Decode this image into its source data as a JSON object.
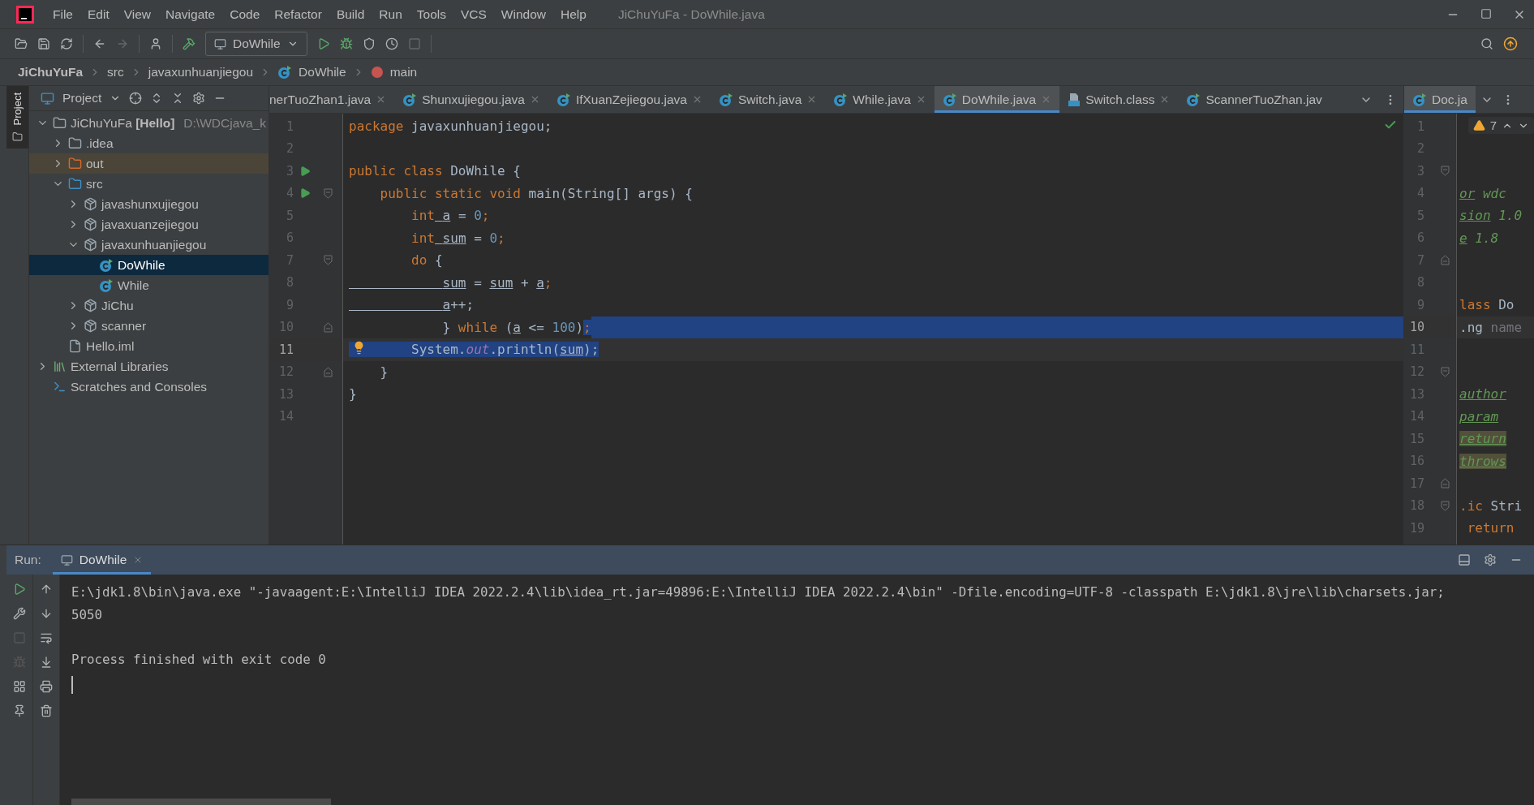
{
  "window": {
    "title": "JiChuYuFa - DoWhile.java"
  },
  "menu": [
    "File",
    "Edit",
    "View",
    "Navigate",
    "Code",
    "Refactor",
    "Build",
    "Run",
    "Tools",
    "VCS",
    "Window",
    "Help"
  ],
  "toolbar": {
    "run_configuration": "DoWhile"
  },
  "breadcrumbs": [
    {
      "label": "JiChuYuFa",
      "kind": "project"
    },
    {
      "label": "src",
      "kind": "folder"
    },
    {
      "label": "javaxunhuanjiegou",
      "kind": "folder"
    },
    {
      "label": "DoWhile",
      "kind": "class"
    },
    {
      "label": "main",
      "kind": "method"
    }
  ],
  "side_strip": {
    "label": "Project"
  },
  "project_panel": {
    "title": "Project",
    "tree": [
      {
        "label": "JiChuYuFa **[Hello]**",
        "path": "D:\\WDCjava_k",
        "kind": "module",
        "expanded": true,
        "selected": false,
        "children": [
          {
            "label": ".idea",
            "kind": "folder",
            "expanded": false,
            "selected": false
          },
          {
            "label": "out",
            "kind": "excluded",
            "expanded": false,
            "selected": false
          },
          {
            "label": "src",
            "kind": "source",
            "expanded": true,
            "selected": false,
            "children": [
              {
                "label": "javashunxujiegou",
                "kind": "package",
                "expanded": false,
                "selected": false
              },
              {
                "label": "javaxuanzejiegou",
                "kind": "package",
                "expanded": false,
                "selected": false
              },
              {
                "label": "javaxunhuanjiegou",
                "kind": "package",
                "expanded": true,
                "selected": false,
                "children": [
                  {
                    "label": "DoWhile",
                    "kind": "class",
                    "selected": true
                  },
                  {
                    "label": "While",
                    "kind": "class",
                    "selected": false
                  }
                ]
              },
              {
                "label": "JiChu",
                "kind": "package",
                "expanded": false,
                "selected": false
              },
              {
                "label": "scanner",
                "kind": "package",
                "expanded": false,
                "selected": false
              }
            ]
          },
          {
            "label": "Hello.iml",
            "kind": "iml",
            "selected": false
          }
        ]
      },
      {
        "label": "External Libraries",
        "kind": "libraries",
        "expanded": false,
        "selected": false
      },
      {
        "label": "Scratches and Consoles",
        "kind": "scratches",
        "selected": false
      }
    ]
  },
  "editor_tabs": [
    {
      "label": "nerTuoZhan1.java",
      "selected": false,
      "closable": true
    },
    {
      "label": "Shunxujiegou.java",
      "kind": "class",
      "selected": false,
      "closable": true
    },
    {
      "label": "IfXuanZejiegou.java",
      "kind": "class",
      "selected": false,
      "closable": true
    },
    {
      "label": "Switch.java",
      "kind": "class",
      "selected": false,
      "closable": true
    },
    {
      "label": "While.java",
      "kind": "class",
      "selected": false,
      "closable": true
    },
    {
      "label": "DoWhile.java",
      "kind": "class",
      "selected": true,
      "closable": true
    },
    {
      "label": "Switch.class",
      "kind": "compiled",
      "selected": false,
      "closable": true
    },
    {
      "label": "ScannerTuoZhan.jav",
      "kind": "class",
      "selected": false,
      "closable": false
    }
  ],
  "editor": {
    "inspection_ok": true,
    "lines": [
      {
        "number": "1",
        "kind": "plain",
        "tokens": [
          {
            "text": "package",
            "kind": "keyword",
            "selected": false
          },
          {
            "text": " javaxunhuanjiegou;",
            "kind": "plain",
            "selected": false
          }
        ]
      },
      {
        "number": "2",
        "kind": "plain"
      },
      {
        "number": "3",
        "kind": "plain",
        "run_marker": true,
        "tokens": [
          {
            "text": "public class",
            "kind": "keyword",
            "selected": false
          },
          {
            "text": " DoWhile {",
            "kind": "plain",
            "selected": false
          }
        ]
      },
      {
        "number": "4",
        "kind": "fold_start",
        "run_marker": true,
        "tokens": [
          {
            "text": "    public static void",
            "kind": "keyword",
            "selected": false
          },
          {
            "text": " main(String[] args) {",
            "kind": "plain",
            "selected": false
          }
        ]
      },
      {
        "number": "5",
        "kind": "plain",
        "tokens": [
          {
            "text": "        int",
            "kind": "keyword",
            "selected": false
          },
          {
            "text": " a",
            "kind": "variable",
            "selected": false
          },
          {
            "text": " = ",
            "kind": "plain",
            "selected": false
          },
          {
            "text": "0",
            "kind": "number",
            "selected": false
          },
          {
            "text": ";",
            "kind": "keyword",
            "selected": false
          }
        ]
      },
      {
        "number": "6",
        "kind": "plain",
        "tokens": [
          {
            "text": "        int",
            "kind": "keyword",
            "selected": false
          },
          {
            "text": " sum",
            "kind": "variable",
            "selected": false
          },
          {
            "text": " = ",
            "kind": "plain",
            "selected": false
          },
          {
            "text": "0",
            "kind": "number",
            "selected": false
          },
          {
            "text": ";",
            "kind": "keyword",
            "selected": false
          }
        ]
      },
      {
        "number": "7",
        "kind": "fold_start",
        "tokens": [
          {
            "text": "        do",
            "kind": "keyword",
            "selected": false
          },
          {
            "text": " {",
            "kind": "plain",
            "selected": false
          }
        ]
      },
      {
        "number": "8",
        "kind": "plain",
        "tokens": [
          {
            "text": "            sum",
            "kind": "variable",
            "selected": false
          },
          {
            "text": " = ",
            "kind": "plain",
            "selected": false
          },
          {
            "text": "sum",
            "kind": "variable",
            "selected": false
          },
          {
            "text": " + ",
            "kind": "plain",
            "selected": false
          },
          {
            "text": "a",
            "kind": "variable",
            "selected": false
          },
          {
            "text": ";",
            "kind": "keyword",
            "selected": false
          }
        ]
      },
      {
        "number": "9",
        "kind": "plain",
        "tokens": [
          {
            "text": "            a",
            "kind": "variable",
            "selected": false
          },
          {
            "text": "++;",
            "kind": "plain",
            "selected": false
          }
        ]
      },
      {
        "number": "10",
        "kind": "fold_end",
        "selected_to_end": true,
        "tokens": [
          {
            "text": "            } ",
            "kind": "plain",
            "selected": false
          },
          {
            "text": "while",
            "kind": "keyword",
            "selected": false
          },
          {
            "text": " (",
            "kind": "plain",
            "selected": false
          },
          {
            "text": "a",
            "kind": "variable",
            "selected": false
          },
          {
            "text": " <= ",
            "kind": "plain",
            "selected": false
          },
          {
            "text": "100",
            "kind": "number",
            "selected": false
          },
          {
            "text": ")",
            "kind": "plain",
            "selected": false
          },
          {
            "text": ";",
            "kind": "keyword",
            "selected": true
          }
        ]
      },
      {
        "number": "11",
        "kind": "plain",
        "current": true,
        "intention_bulb": true,
        "tokens": [
          {
            "text": "        System.",
            "kind": "plain",
            "selected": true
          },
          {
            "text": "out",
            "kind": "static",
            "selected": true
          },
          {
            "text": ".println(",
            "kind": "plain",
            "selected": true
          },
          {
            "text": "sum",
            "kind": "variable",
            "selected": true
          },
          {
            "text": ");",
            "kind": "plain",
            "selected": true
          }
        ]
      },
      {
        "number": "12",
        "kind": "fold_end",
        "tokens": [
          {
            "text": "    }",
            "kind": "plain",
            "selected": false
          }
        ]
      },
      {
        "number": "13",
        "kind": "plain",
        "tokens": [
          {
            "text": "}",
            "kind": "plain",
            "selected": false
          }
        ]
      },
      {
        "number": "14",
        "kind": "plain"
      }
    ]
  },
  "split_tab": {
    "label": "Doc.ja",
    "kind": "class",
    "selected": true
  },
  "split_editor": {
    "warnings": "7",
    "lines": [
      {
        "number": "1",
        "kind": "plain"
      },
      {
        "number": "2",
        "kind": "plain"
      },
      {
        "number": "3",
        "kind": "fold_start"
      },
      {
        "number": "4",
        "kind": "plain",
        "tokens": [
          {
            "text": "or",
            "kind": "doc_tag"
          },
          {
            "text": " wdc",
            "kind": "doc"
          }
        ]
      },
      {
        "number": "5",
        "kind": "plain",
        "tokens": [
          {
            "text": "sion",
            "kind": "doc_tag"
          },
          {
            "text": " 1.0",
            "kind": "doc"
          }
        ]
      },
      {
        "number": "6",
        "kind": "plain",
        "tokens": [
          {
            "text": "e",
            "kind": "doc_tag"
          },
          {
            "text": " 1.8",
            "kind": "doc"
          }
        ]
      },
      {
        "number": "7",
        "kind": "fold_end"
      },
      {
        "number": "8",
        "kind": "plain"
      },
      {
        "number": "9",
        "kind": "plain",
        "tokens": [
          {
            "text": "lass",
            "kind": "keyword"
          },
          {
            "text": " Do",
            "kind": "plain"
          }
        ]
      },
      {
        "number": "10",
        "kind": "plain",
        "current": true,
        "tokens": [
          {
            "text": ".ng",
            "kind": "plain"
          },
          {
            "text": " name",
            "kind": "unused"
          }
        ]
      },
      {
        "number": "11",
        "kind": "plain"
      },
      {
        "number": "12",
        "kind": "fold_start"
      },
      {
        "number": "13",
        "kind": "plain",
        "tokens": [
          {
            "text": "author",
            "kind": "doc_tag"
          }
        ]
      },
      {
        "number": "14",
        "kind": "plain",
        "tokens": [
          {
            "text": "param",
            "kind": "doc_tag"
          }
        ]
      },
      {
        "number": "15",
        "kind": "plain",
        "tokens": [
          {
            "text": "return",
            "kind": "doc_tag_marked"
          }
        ]
      },
      {
        "number": "16",
        "kind": "plain",
        "tokens": [
          {
            "text": "throws",
            "kind": "doc_tag_marked"
          }
        ]
      },
      {
        "number": "17",
        "kind": "fold_end"
      },
      {
        "number": "18",
        "kind": "fold_start",
        "tokens": [
          {
            "text": ".ic",
            "kind": "keyword"
          },
          {
            "text": " Stri",
            "kind": "plain"
          }
        ]
      },
      {
        "number": "19",
        "kind": "plain",
        "tokens": [
          {
            "text": " return",
            "kind": "keyword"
          }
        ]
      }
    ]
  },
  "run_panel": {
    "label": "Run:",
    "tab": {
      "label": "DoWhile",
      "selected": true
    },
    "console_blocks": [
      {
        "lines": [
          "E:\\jdk1.8\\bin\\java.exe \"-javaagent:E:\\IntelliJ IDEA 2022.2.4\\lib\\idea_rt.jar=49896:E:\\IntelliJ IDEA 2022.2.4\\bin\" -Dfile.encoding=UTF-8 -classpath E:\\jdk1.8\\jre\\lib\\charsets.jar;",
          "5050"
        ]
      },
      {
        "lines": [
          "Process finished with exit code 0"
        ]
      }
    ]
  }
}
